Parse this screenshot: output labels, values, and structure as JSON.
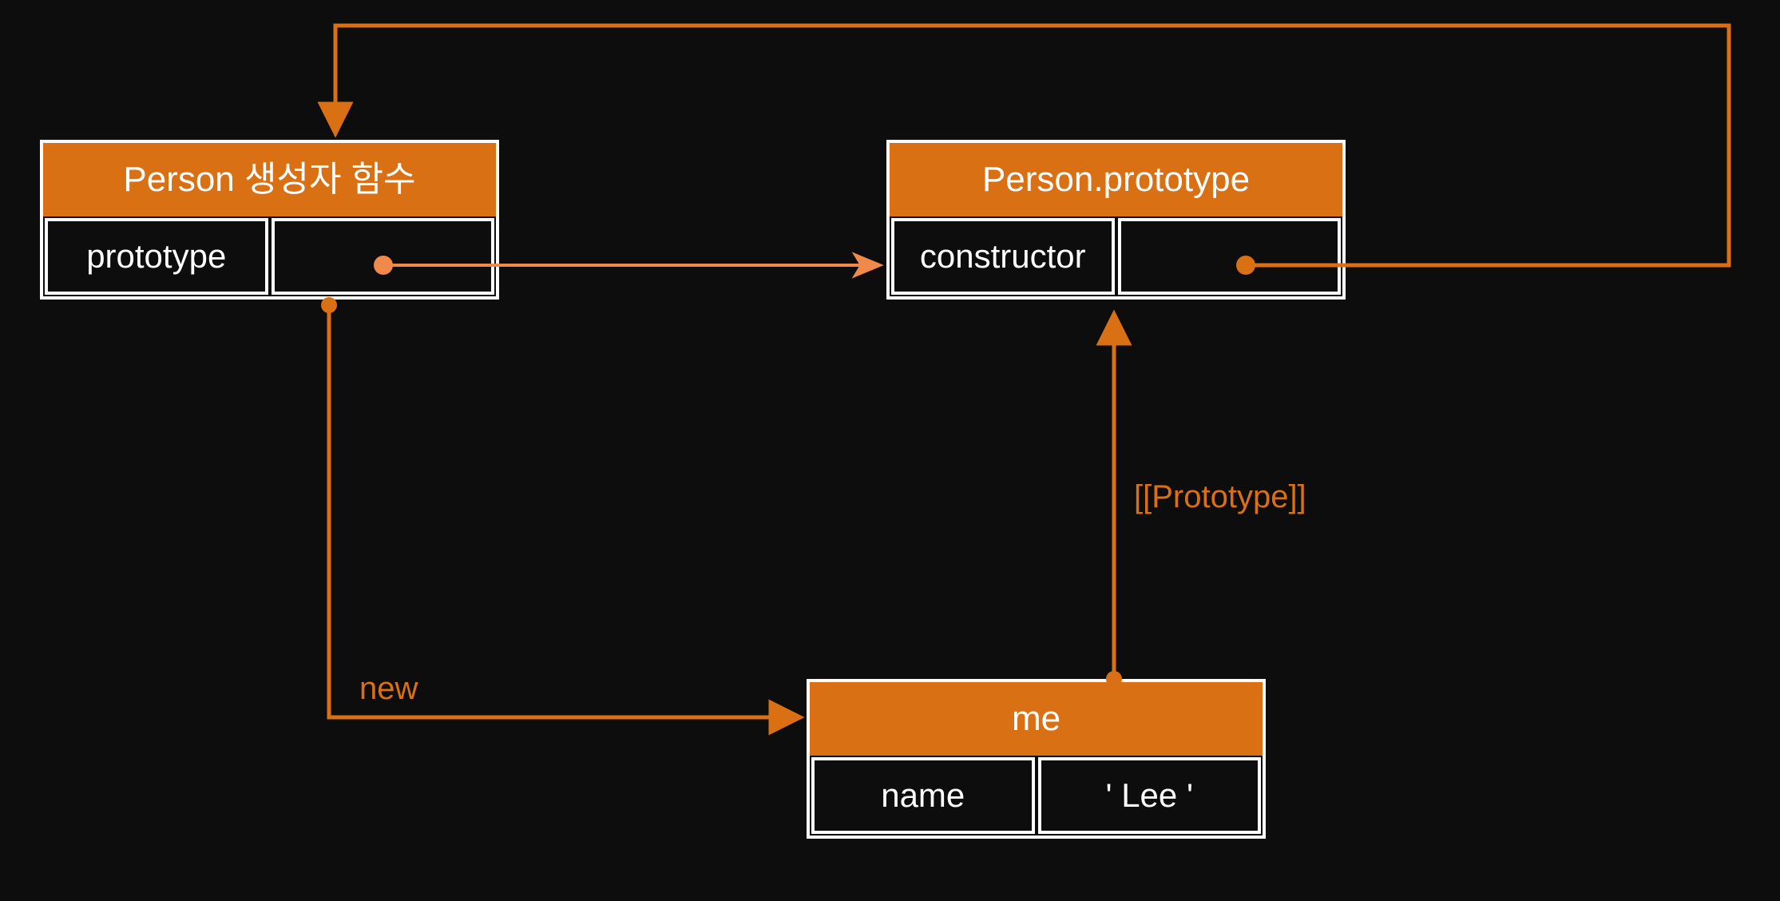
{
  "diagram": {
    "objects": {
      "person": {
        "title": "Person 생성자 함수",
        "prop_key": "prototype",
        "prop_val": ""
      },
      "prototype": {
        "title": "Person.prototype",
        "prop_key": "constructor",
        "prop_val": ""
      },
      "me": {
        "title": "me",
        "prop_key": "name",
        "prop_val": "' Lee '"
      }
    },
    "edges": {
      "new_label": "new",
      "proto_label": "[[Prototype]]"
    },
    "colors": {
      "accent": "#d97014",
      "fg": "#fdfdfd",
      "bg": "#0d0d0d"
    }
  }
}
